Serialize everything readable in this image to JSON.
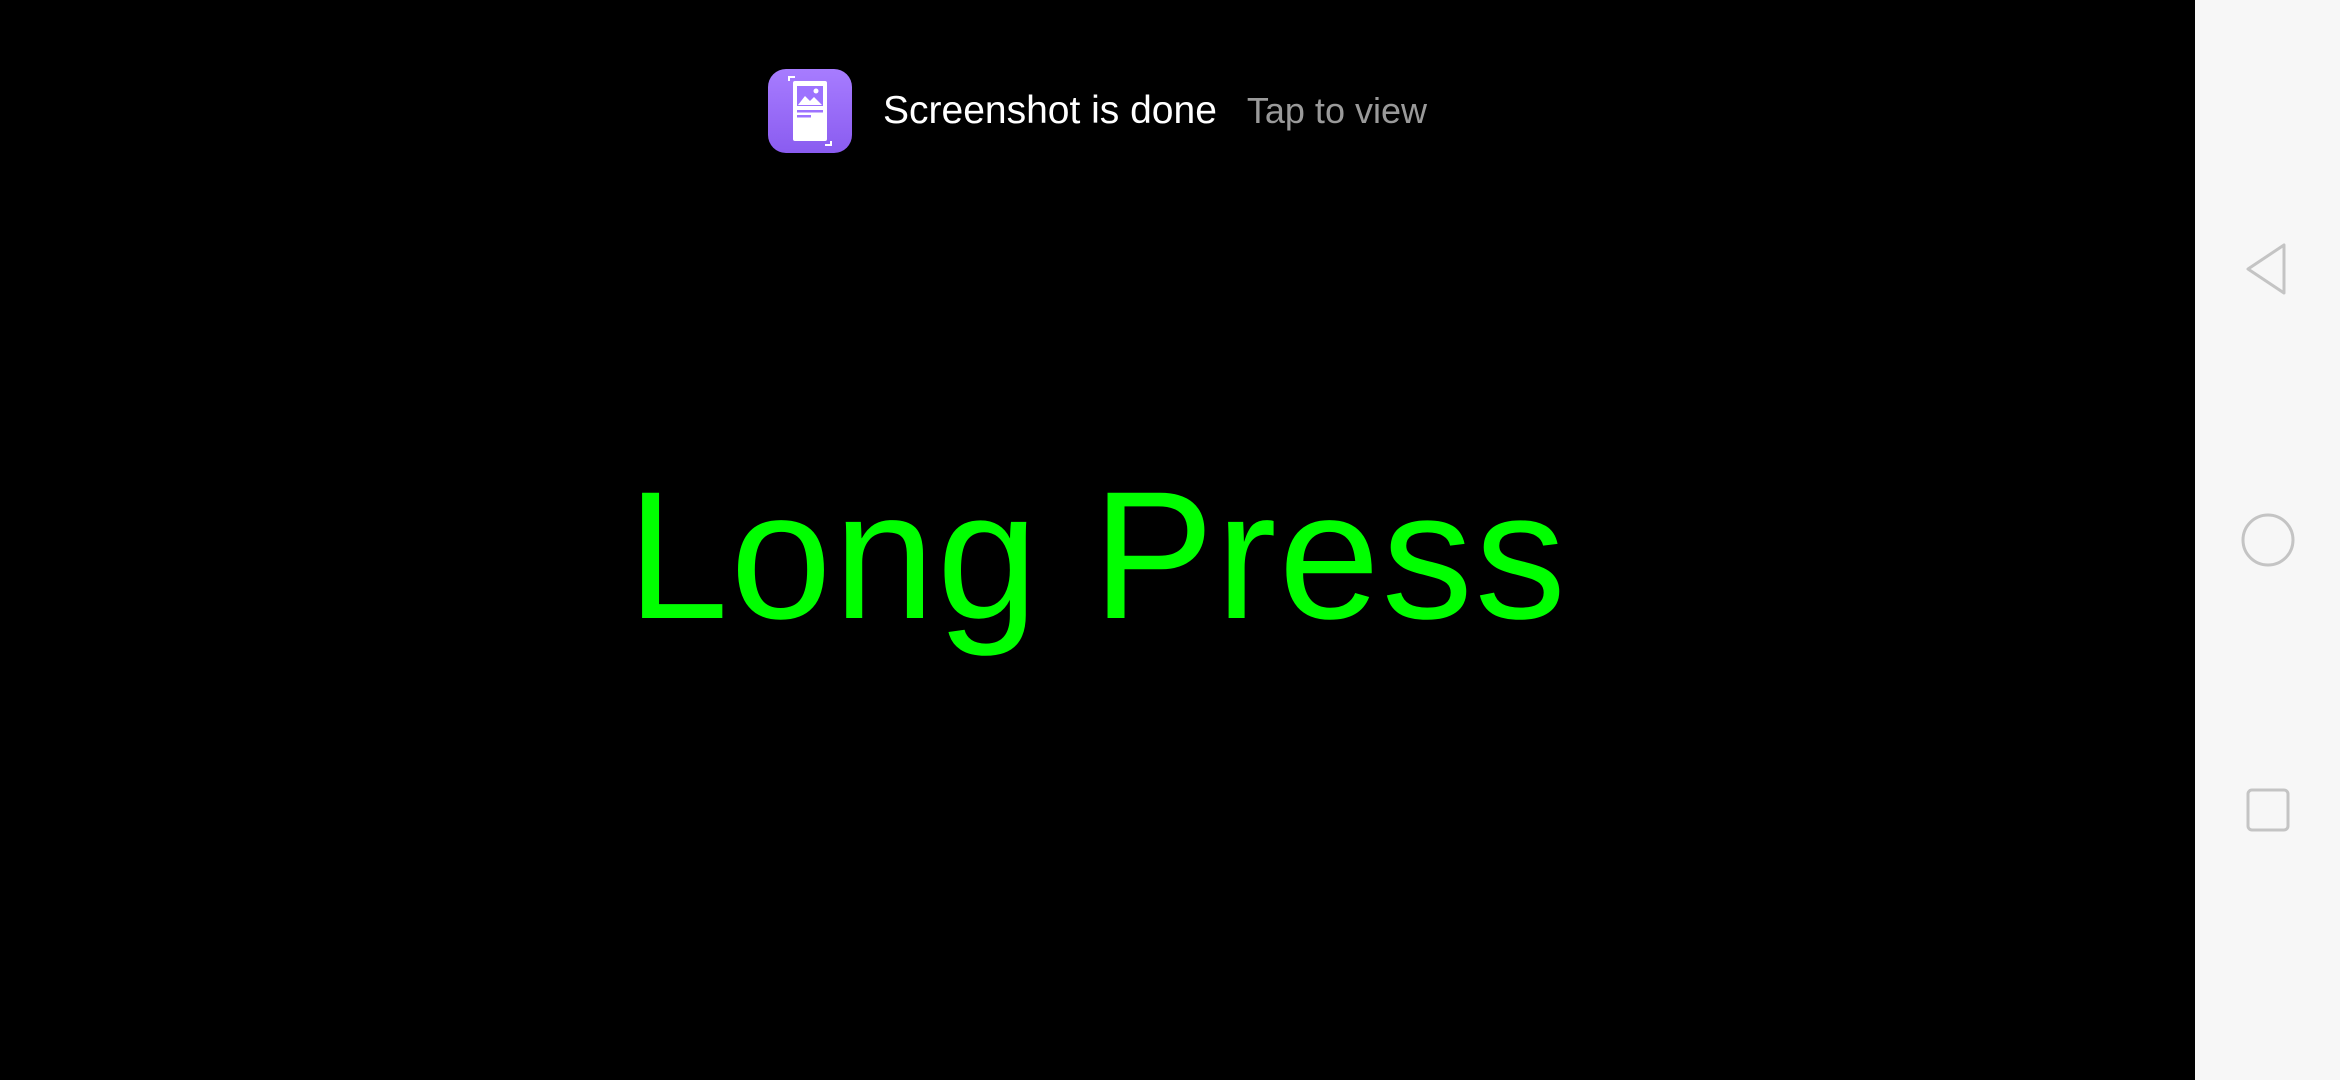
{
  "toast": {
    "icon": "screenshot-icon",
    "title": "Screenshot is done",
    "action": "Tap to view"
  },
  "main": {
    "label": "Long Press",
    "label_color": "#00ff00",
    "background": "#000000"
  },
  "nav_bar": {
    "buttons": [
      "back-icon",
      "home-icon",
      "recents-icon"
    ],
    "background": "#f7f7f7"
  }
}
